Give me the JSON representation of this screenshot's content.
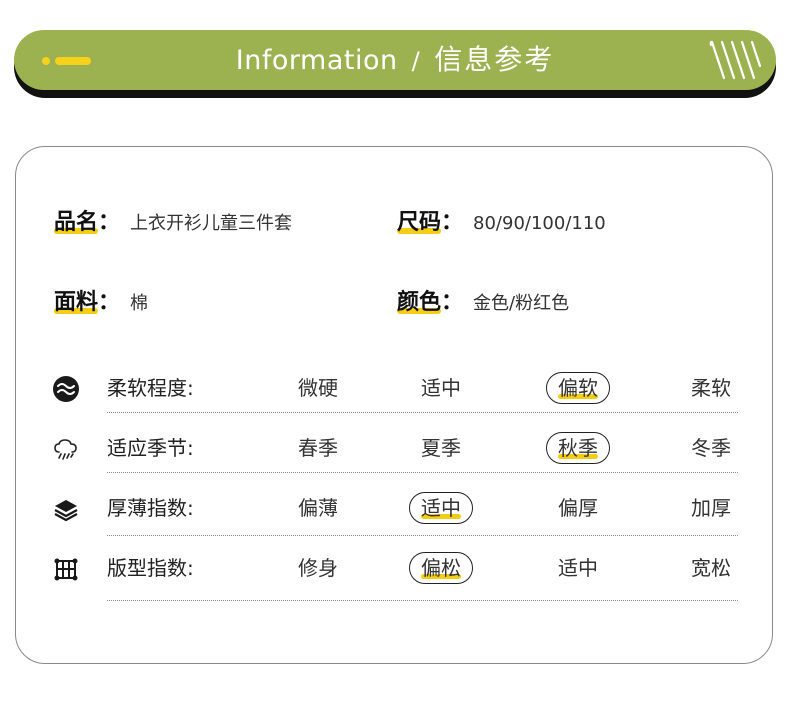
{
  "header": {
    "title_en": "Information",
    "separator": "/",
    "title_cn": "信息参考"
  },
  "colors": {
    "banner": "#9cb251",
    "accent": "#f3cd16",
    "shadow": "#111111"
  },
  "info": {
    "name_label": "品名",
    "name_value": "上衣开衫儿童三件套",
    "size_label": "尺码",
    "size_value": "80/90/100/110",
    "fabric_label": "面料",
    "fabric_value": "棉",
    "color_label": "颜色",
    "color_value": "金色/粉红色",
    "colon": "："
  },
  "attributes": [
    {
      "icon": "wave-icon",
      "label": "柔软程度:",
      "options": [
        "微硬",
        "适中",
        "偏软",
        "柔软"
      ],
      "selected": 2
    },
    {
      "icon": "cloud-rain-icon",
      "label": "适应季节:",
      "options": [
        "春季",
        "夏季",
        "秋季",
        "冬季"
      ],
      "selected": 2
    },
    {
      "icon": "layers-icon",
      "label": "厚薄指数:",
      "options": [
        "偏薄",
        "适中",
        "偏厚",
        "加厚"
      ],
      "selected": 1
    },
    {
      "icon": "grid-frame-icon",
      "label": "版型指数:",
      "options": [
        "修身",
        "偏松",
        "适中",
        "宽松"
      ],
      "selected": 1
    }
  ]
}
